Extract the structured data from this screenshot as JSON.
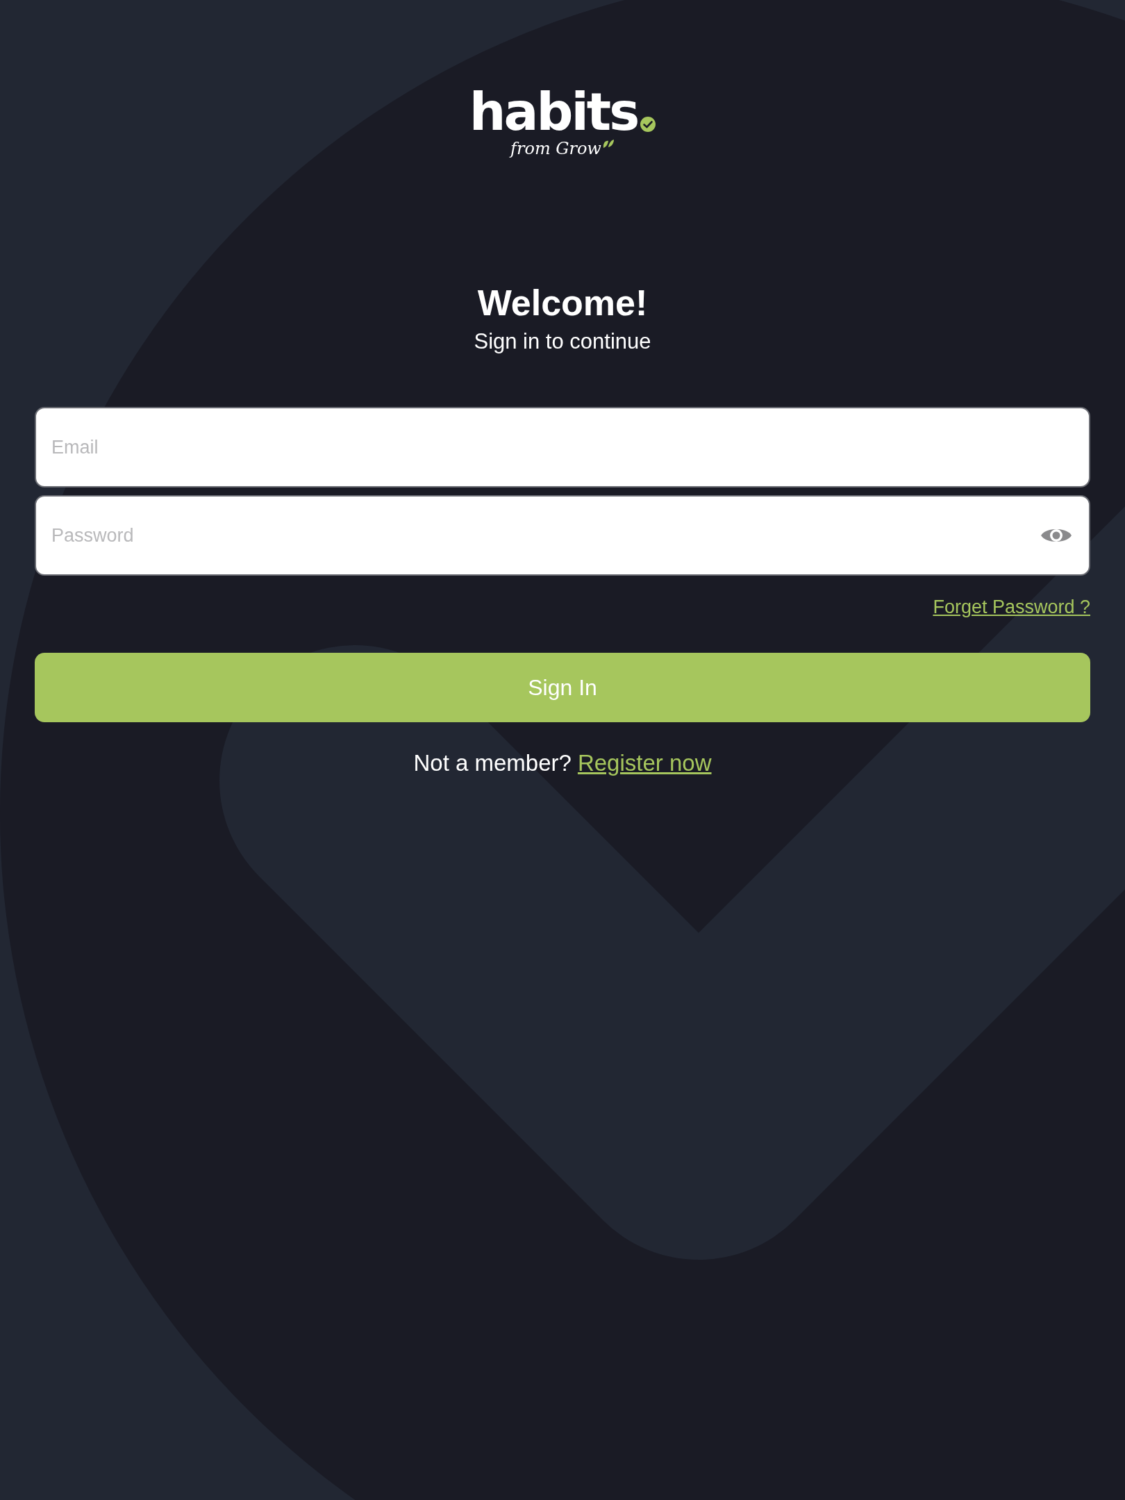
{
  "logo": {
    "wordmark": "habits",
    "tagline": "from Grow"
  },
  "heading": {
    "title": "Welcome!",
    "subtitle": "Sign in to continue"
  },
  "fields": [
    {
      "kind": "email",
      "placeholder": "Email"
    },
    {
      "kind": "password",
      "placeholder": "Password"
    }
  ],
  "forgot_link": "Forget Password ?",
  "primary_button": "Sign In",
  "register": {
    "prompt": "Not a member?",
    "link": "Register now"
  }
}
